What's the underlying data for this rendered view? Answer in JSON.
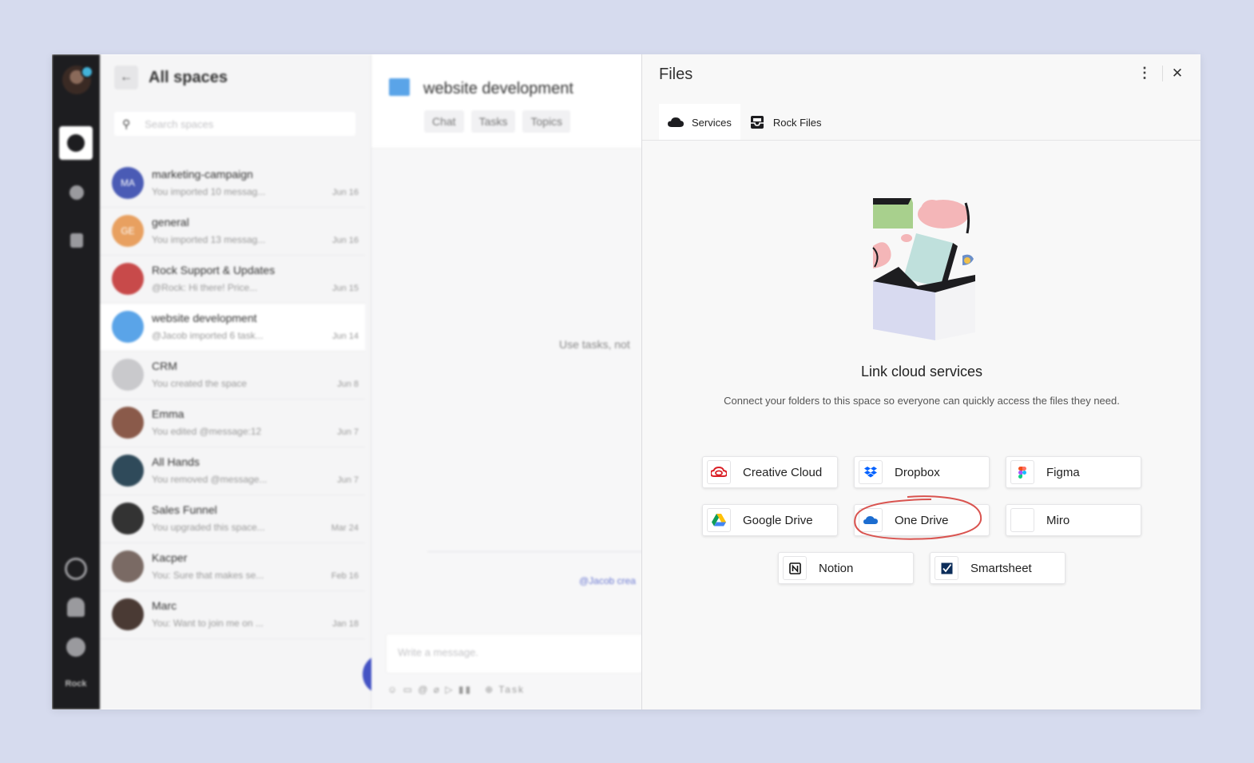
{
  "rail": {
    "brand": "Rock"
  },
  "spaces": {
    "title": "All spaces",
    "search_placeholder": "Search spaces",
    "items": [
      {
        "name": "marketing-campaign",
        "sub": "You imported 10 messag...",
        "date": "Jun 16",
        "initials": "MA",
        "color": "#4a5bb5"
      },
      {
        "name": "general",
        "sub": "You imported 13 messag...",
        "date": "Jun 16",
        "initials": "GE",
        "color": "#e8a060"
      },
      {
        "name": "Rock Support & Updates",
        "sub": "@Rock: Hi there! Price...",
        "date": "Jun 15",
        "initials": "",
        "color": "#c84a4a"
      },
      {
        "name": "website development",
        "sub": "@Jacob imported 6 task...",
        "date": "Jun 14",
        "initials": "",
        "color": "#5aa4e8"
      },
      {
        "name": "CRM",
        "sub": "You created the space",
        "date": "Jun 8",
        "initials": "",
        "color": "#c9c9cc"
      },
      {
        "name": "Emma",
        "sub": "You edited @message:12",
        "date": "Jun 7",
        "initials": "",
        "color": "#8a5a4a"
      },
      {
        "name": "All Hands",
        "sub": "You removed @message...",
        "date": "Jun 7",
        "initials": "",
        "color": "#2f4a5a"
      },
      {
        "name": "Sales Funnel",
        "sub": "You upgraded this space...",
        "date": "Mar 24",
        "initials": "",
        "color": "#333333"
      },
      {
        "name": "Kacper",
        "sub": "You: Sure that makes se...",
        "date": "Feb 16",
        "initials": "",
        "color": "#7a6a64"
      },
      {
        "name": "Marc",
        "sub": "You: Want to join me on ...",
        "date": "Jan 18",
        "initials": "",
        "color": "#4a3a34"
      }
    ]
  },
  "chat": {
    "title": "website development",
    "tabs": [
      "Chat",
      "Tasks",
      "Topics"
    ],
    "empty_text": "Use tasks, not",
    "event_text": "@Jacob crea",
    "input_placeholder": "Write a message.",
    "toolbar_text": "Task"
  },
  "files": {
    "title": "Files",
    "tabs": [
      {
        "label": "Services",
        "icon": "cloud-icon",
        "active": true
      },
      {
        "label": "Rock Files",
        "icon": "inbox-icon",
        "active": false
      }
    ],
    "hero_title": "Link cloud services",
    "hero_sub": "Connect your folders to this space so everyone can quickly access the files they need.",
    "services": [
      {
        "label": "Creative Cloud",
        "icon": "creative-cloud-icon"
      },
      {
        "label": "Dropbox",
        "icon": "dropbox-icon"
      },
      {
        "label": "Figma",
        "icon": "figma-icon"
      },
      {
        "label": "Google Drive",
        "icon": "google-drive-icon"
      },
      {
        "label": "One Drive",
        "icon": "onedrive-icon",
        "highlighted": true
      },
      {
        "label": "Miro",
        "icon": "miro-icon"
      },
      {
        "label": "Notion",
        "icon": "notion-icon"
      },
      {
        "label": "Smartsheet",
        "icon": "smartsheet-icon"
      }
    ],
    "highlight_color": "#d9534f"
  }
}
